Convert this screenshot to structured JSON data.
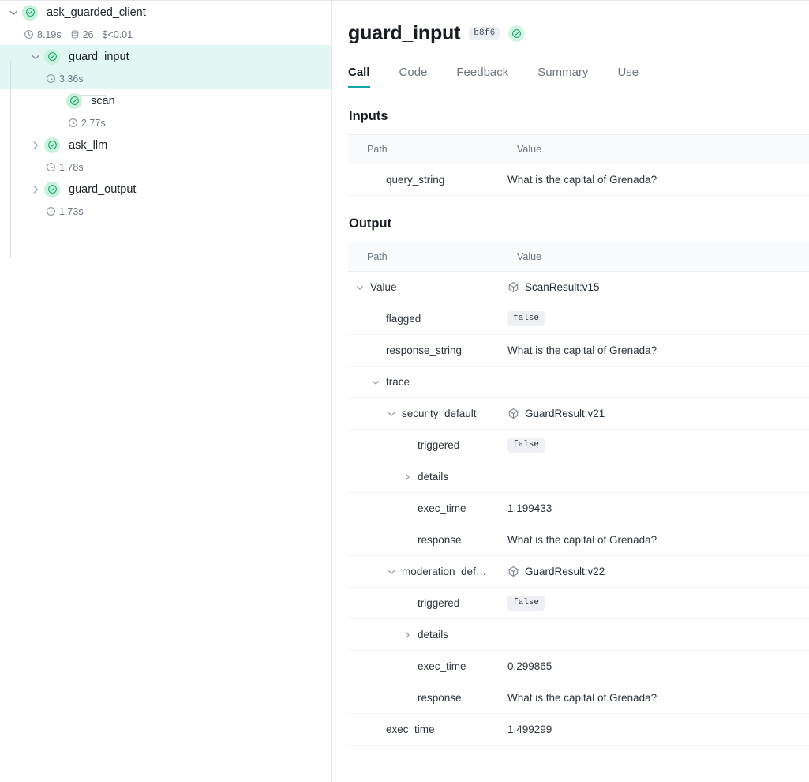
{
  "tree": {
    "nodes": [
      {
        "id": "ask_guarded_client",
        "label": "ask_guarded_client",
        "depth": 0,
        "expanded": true,
        "selected": false,
        "status": "success",
        "meta": [
          {
            "icon": "clock-icon",
            "text": "8.19s"
          },
          {
            "icon": "tokens-icon",
            "text": "26"
          },
          {
            "icon": "none",
            "text": "$<0.01"
          }
        ]
      },
      {
        "id": "guard_input",
        "label": "guard_input",
        "depth": 1,
        "expanded": true,
        "selected": true,
        "status": "success",
        "meta": [
          {
            "icon": "clock-icon",
            "text": "3.36s"
          }
        ]
      },
      {
        "id": "scan",
        "label": "scan",
        "depth": 2,
        "expanded": null,
        "selected": false,
        "status": "success",
        "meta": [
          {
            "icon": "clock-icon",
            "text": "2.77s"
          }
        ]
      },
      {
        "id": "ask_llm",
        "label": "ask_llm",
        "depth": 1,
        "expanded": false,
        "selected": false,
        "status": "success",
        "meta": [
          {
            "icon": "clock-icon",
            "text": "1.78s"
          }
        ]
      },
      {
        "id": "guard_output",
        "label": "guard_output",
        "depth": 1,
        "expanded": false,
        "selected": false,
        "status": "success",
        "meta": [
          {
            "icon": "clock-icon",
            "text": "1.73s"
          }
        ]
      }
    ]
  },
  "detail": {
    "title": "guard_input",
    "hash_badge": "b8f6",
    "status": "success",
    "tabs": [
      {
        "label": "Call",
        "active": true
      },
      {
        "label": "Code",
        "active": false
      },
      {
        "label": "Feedback",
        "active": false
      },
      {
        "label": "Summary",
        "active": false
      },
      {
        "label": "Use",
        "active": false
      }
    ],
    "inputs": {
      "heading": "Inputs",
      "columns": [
        "Path",
        "Value"
      ],
      "rows": [
        {
          "indent": 1,
          "twisty": "none",
          "path": "query_string",
          "value_type": "text",
          "value": "What is the capital of Grenada?"
        }
      ]
    },
    "output": {
      "heading": "Output",
      "columns": [
        "Path",
        "Value"
      ],
      "rows": [
        {
          "indent": 0,
          "twisty": "down",
          "path": "Value",
          "value_type": "ref",
          "value": "ScanResult:v15"
        },
        {
          "indent": 1,
          "twisty": "none",
          "path": "flagged",
          "value_type": "badge",
          "value": "false"
        },
        {
          "indent": 1,
          "twisty": "none",
          "path": "response_string",
          "value_type": "text",
          "value": "What is the capital of Grenada?"
        },
        {
          "indent": 1,
          "twisty": "down",
          "path": "trace",
          "value_type": "empty",
          "value": ""
        },
        {
          "indent": 2,
          "twisty": "down",
          "path": "security_default",
          "value_type": "ref",
          "value": "GuardResult:v21"
        },
        {
          "indent": 3,
          "twisty": "none",
          "path": "triggered",
          "value_type": "badge",
          "value": "false"
        },
        {
          "indent": 3,
          "twisty": "right",
          "path": "details",
          "value_type": "empty",
          "value": ""
        },
        {
          "indent": 3,
          "twisty": "none",
          "path": "exec_time",
          "value_type": "text",
          "value": "1.199433"
        },
        {
          "indent": 3,
          "twisty": "none",
          "path": "response",
          "value_type": "text",
          "value": "What is the capital of Grenada?"
        },
        {
          "indent": 2,
          "twisty": "down",
          "path": "moderation_def…",
          "value_type": "ref",
          "value": "GuardResult:v22"
        },
        {
          "indent": 3,
          "twisty": "none",
          "path": "triggered",
          "value_type": "badge",
          "value": "false"
        },
        {
          "indent": 3,
          "twisty": "right",
          "path": "details",
          "value_type": "empty",
          "value": ""
        },
        {
          "indent": 3,
          "twisty": "none",
          "path": "exec_time",
          "value_type": "text",
          "value": "0.299865"
        },
        {
          "indent": 3,
          "twisty": "none",
          "path": "response",
          "value_type": "text",
          "value": "What is the capital of Grenada?"
        },
        {
          "indent": 1,
          "twisty": "none",
          "path": "exec_time",
          "value_type": "text",
          "value": "1.499299"
        }
      ]
    }
  },
  "colors": {
    "accent_teal": "#13a5a5",
    "status_green": "#16a46a",
    "status_green_bg": "#c8f2dc",
    "selected_row_bg": "#e2f7f4",
    "border": "#e4e7eb"
  }
}
